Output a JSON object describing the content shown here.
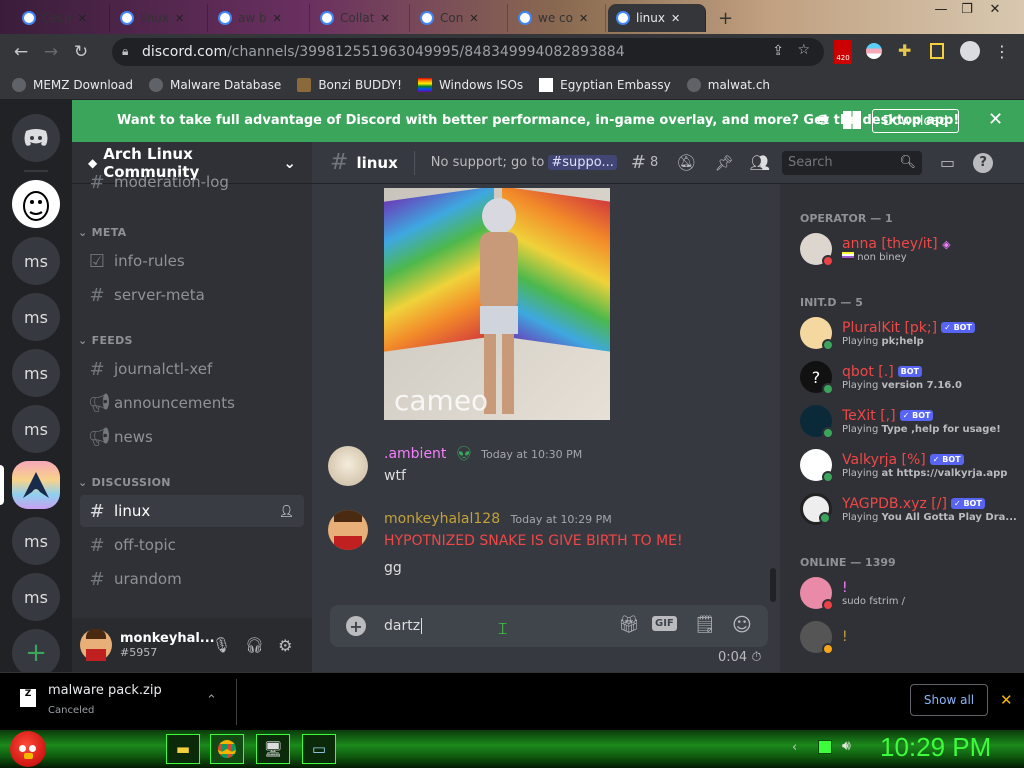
{
  "browser": {
    "tabs": [
      {
        "label": "Cesp"
      },
      {
        "label": "linux"
      },
      {
        "label": "aw b"
      },
      {
        "label": "Collat"
      },
      {
        "label": "Con"
      },
      {
        "label": "we co"
      },
      {
        "label": "linux",
        "active": true
      }
    ],
    "url_host": "discord.com",
    "url_path": "/channels/399812551963049995/848349994082893884",
    "badge": "420",
    "bookmarks": [
      "MEMZ Download",
      "Malware Database",
      "Bonzi BUDDY!",
      "Windows ISOs",
      "Egyptian Embassy",
      "malwat.ch"
    ]
  },
  "banner": {
    "text": "Want to take full advantage of Discord with better performance, in-game overlay, and more? Get the desktop app!",
    "button": "Download"
  },
  "guilds": [
    "ms",
    "ms",
    "ms",
    "ms",
    "ms",
    "ms"
  ],
  "server": {
    "name": "Arch Linux Community",
    "top_channel": "moderation-log",
    "categories": [
      {
        "name": "META",
        "channels": [
          "info-rules",
          "server-meta"
        ]
      },
      {
        "name": "FEEDS",
        "channels": [
          "journalctl-xef",
          "announcements",
          "news"
        ]
      },
      {
        "name": "DISCUSSION",
        "channels": [
          "linux",
          "off-topic",
          "urandom"
        ]
      }
    ]
  },
  "user": {
    "name": "monkeyhal...",
    "tag": "#5957"
  },
  "channel": {
    "name": "linux",
    "topic": "No support; go to",
    "topic_link": "#suppo...",
    "threads": "8",
    "search_placeholder": "Search"
  },
  "messages": [
    {
      "author": ".ambient",
      "time": "Today at 10:30 PM",
      "text": "wtf",
      "author_color": "#f47fff"
    },
    {
      "author": "monkeyhalal128",
      "time": "Today at 10:29 PM",
      "text": "HYPOTNIZED SNAKE IS GIVE BIRTH TO ME!",
      "text2": "gg",
      "author_color": "#c2a23a"
    }
  ],
  "image_watermark": "cameo",
  "composer": {
    "value": "dartz",
    "timer": "0:04",
    "gif": "GIF"
  },
  "members": {
    "groups": [
      {
        "title": "OPERATOR — 1",
        "items": [
          {
            "name": "anna [they/it]",
            "sub": "non biney",
            "status": "dnd"
          }
        ]
      },
      {
        "title": "INIT.D — 5",
        "items": [
          {
            "name": "PluralKit [pk;]",
            "bot": true,
            "sub_prefix": "Playing ",
            "sub": "pk;help",
            "status": "online"
          },
          {
            "name": "qbot [.]",
            "bot": true,
            "sub_prefix": "Playing ",
            "sub": "version 7.16.0",
            "status": "online"
          },
          {
            "name": "TeXit [,]",
            "bot": true,
            "sub_prefix": "Playing ",
            "sub": "Type ,help for usage!",
            "status": "online"
          },
          {
            "name": "Valkyrja [%]",
            "bot": true,
            "sub_prefix": "Playing ",
            "sub": "at https://valkyrja.app",
            "status": "online"
          },
          {
            "name": "YAGPDB.xyz [/]",
            "bot": true,
            "sub_prefix": "Playing ",
            "sub": "You All Gotta Play Dra...",
            "status": "online"
          }
        ]
      },
      {
        "title": "ONLINE — 1399",
        "items": [
          {
            "name": "!",
            "sub": "sudo fstrim /",
            "status": "dnd"
          },
          {
            "name": "!",
            "sub": "",
            "status": "idle"
          }
        ]
      }
    ],
    "bot_label": "BOT"
  },
  "download": {
    "file": "malware pack.zip",
    "status": "Canceled",
    "show_all": "Show all"
  },
  "taskbar": {
    "clock": "10:29 PM"
  }
}
